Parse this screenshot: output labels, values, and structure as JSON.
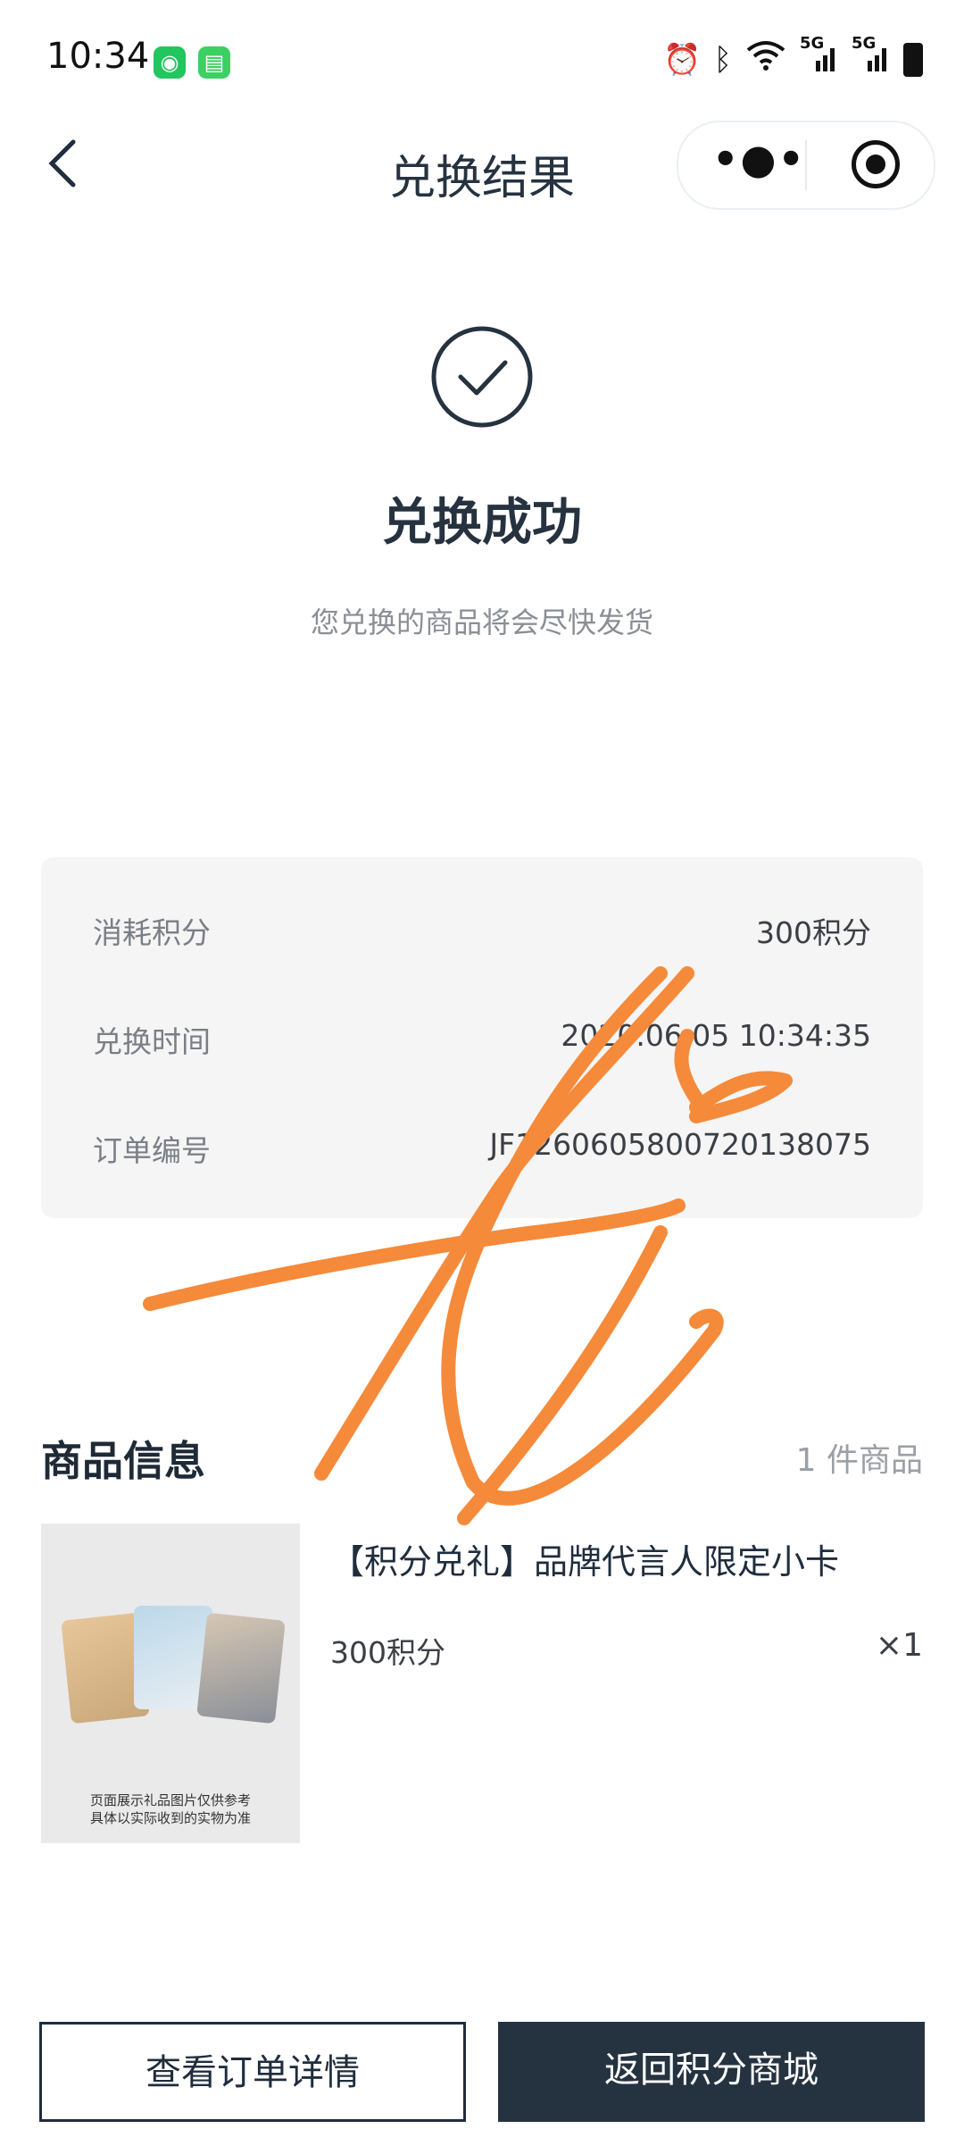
{
  "status_bar": {
    "time": "10:34",
    "app_icons": [
      "wechat-icon",
      "messages-icon"
    ],
    "system_icons": [
      "alarm-icon",
      "bluetooth-icon",
      "wifi-icon",
      "signal-5g-icon",
      "signal-5g-icon",
      "battery-icon"
    ],
    "network_label_1": "5G",
    "network_label_2": "5G"
  },
  "nav": {
    "back_icon": "chevron-left-icon",
    "title": "兑换结果",
    "more_icon": "more-dots-icon",
    "close_icon": "target-close-icon"
  },
  "result": {
    "icon": "check-circle-icon",
    "title": "兑换成功",
    "subtitle": "您兑换的商品将会尽快发货"
  },
  "info": {
    "points_label": "消耗积分",
    "points_value": "300积分",
    "time_label": "兑换时间",
    "time_value": "2020.06.05 10:34:35",
    "order_label": "订单编号",
    "order_value": "JF1260605800720138075"
  },
  "goods": {
    "section_title": "商品信息",
    "count_text": "1 件商品",
    "item": {
      "name": "【积分兑礼】品牌代言人限定小卡",
      "points": "300积分",
      "quantity": "×1",
      "image_note_line1": "页面展示礼品图片仅供参考",
      "image_note_line2": "具体以实际收到的实物为准"
    }
  },
  "buttons": {
    "view_order": "查看订单详情",
    "back_to_mall": "返回积分商城"
  },
  "colors": {
    "primary": "#253341",
    "text_dark": "#1f2d3d",
    "card_bg": "#f5f5f5",
    "scribble": "#f58a3a"
  }
}
